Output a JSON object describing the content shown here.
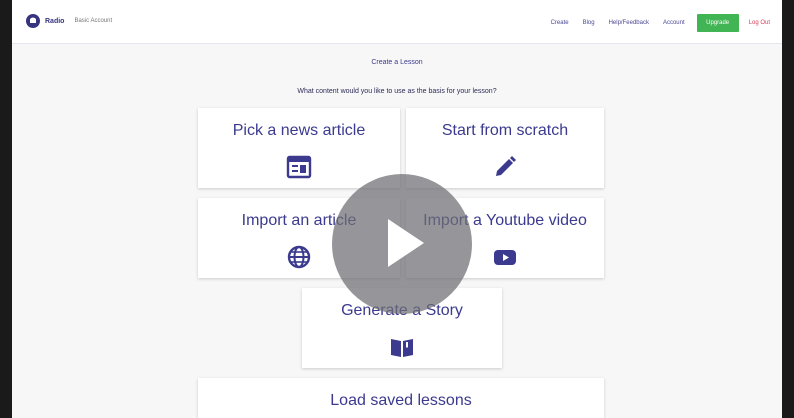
{
  "header": {
    "logo_text": "Radio",
    "account_type": "Basic Account",
    "nav": [
      "Create",
      "Blog",
      "Help/Feedback",
      "Account"
    ],
    "upgrade_label": "Upgrade",
    "logout_label": "Log Out",
    "upgrade_color": "#41b553",
    "logout_color": "#d9415a",
    "brand_color": "#36347f"
  },
  "main": {
    "heading": "Create a Lesson",
    "question": "What content would you like to use as the basis for your lesson?",
    "options": [
      {
        "label": "Pick a news article",
        "icon": "news-article-icon"
      },
      {
        "label": "Start from scratch",
        "icon": "pencil-icon"
      },
      {
        "label": "Import an article",
        "icon": "globe-icon"
      },
      {
        "label": "Import a Youtube video",
        "icon": "youtube-icon"
      },
      {
        "label": "Generate a Story",
        "icon": "open-book-icon"
      },
      {
        "label": "Load saved lessons",
        "icon": "folder-icon"
      }
    ]
  },
  "video_overlay": {
    "icon": "play-icon"
  }
}
